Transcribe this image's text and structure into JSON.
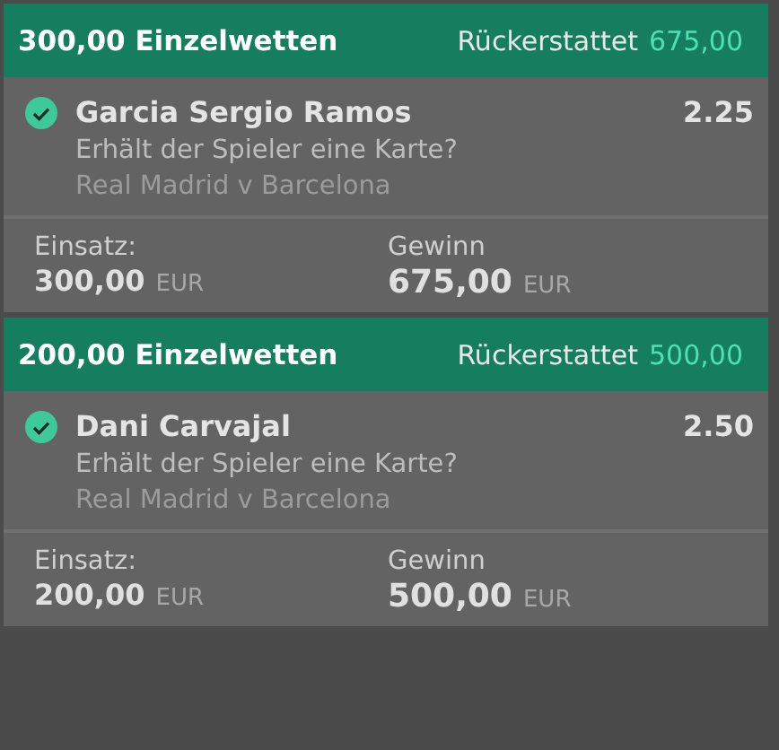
{
  "bets": [
    {
      "title": "300,00 Einzelwetten",
      "refund_label": "Rückerstattet",
      "refund_amount": "675,00",
      "selection": {
        "name": "Garcia Sergio Ramos",
        "won": true,
        "odds": "2.25",
        "market": "Erhält der Spieler eine Karte?",
        "event": "Real Madrid v Barcelona"
      },
      "stake_label": "Einsatz:",
      "stake": "300,00",
      "stake_currency": "EUR",
      "return_label": "Gewinn",
      "return": "675,00",
      "return_currency": "EUR"
    },
    {
      "title": "200,00 Einzelwetten",
      "refund_label": "Rückerstattet",
      "refund_amount": "500,00",
      "selection": {
        "name": "Dani Carvajal",
        "won": true,
        "odds": "2.50",
        "market": "Erhält der Spieler eine Karte?",
        "event": "Real Madrid v Barcelona"
      },
      "stake_label": "Einsatz:",
      "stake": "200,00",
      "stake_currency": "EUR",
      "return_label": "Gewinn",
      "return": "500,00",
      "return_currency": "EUR"
    }
  ]
}
